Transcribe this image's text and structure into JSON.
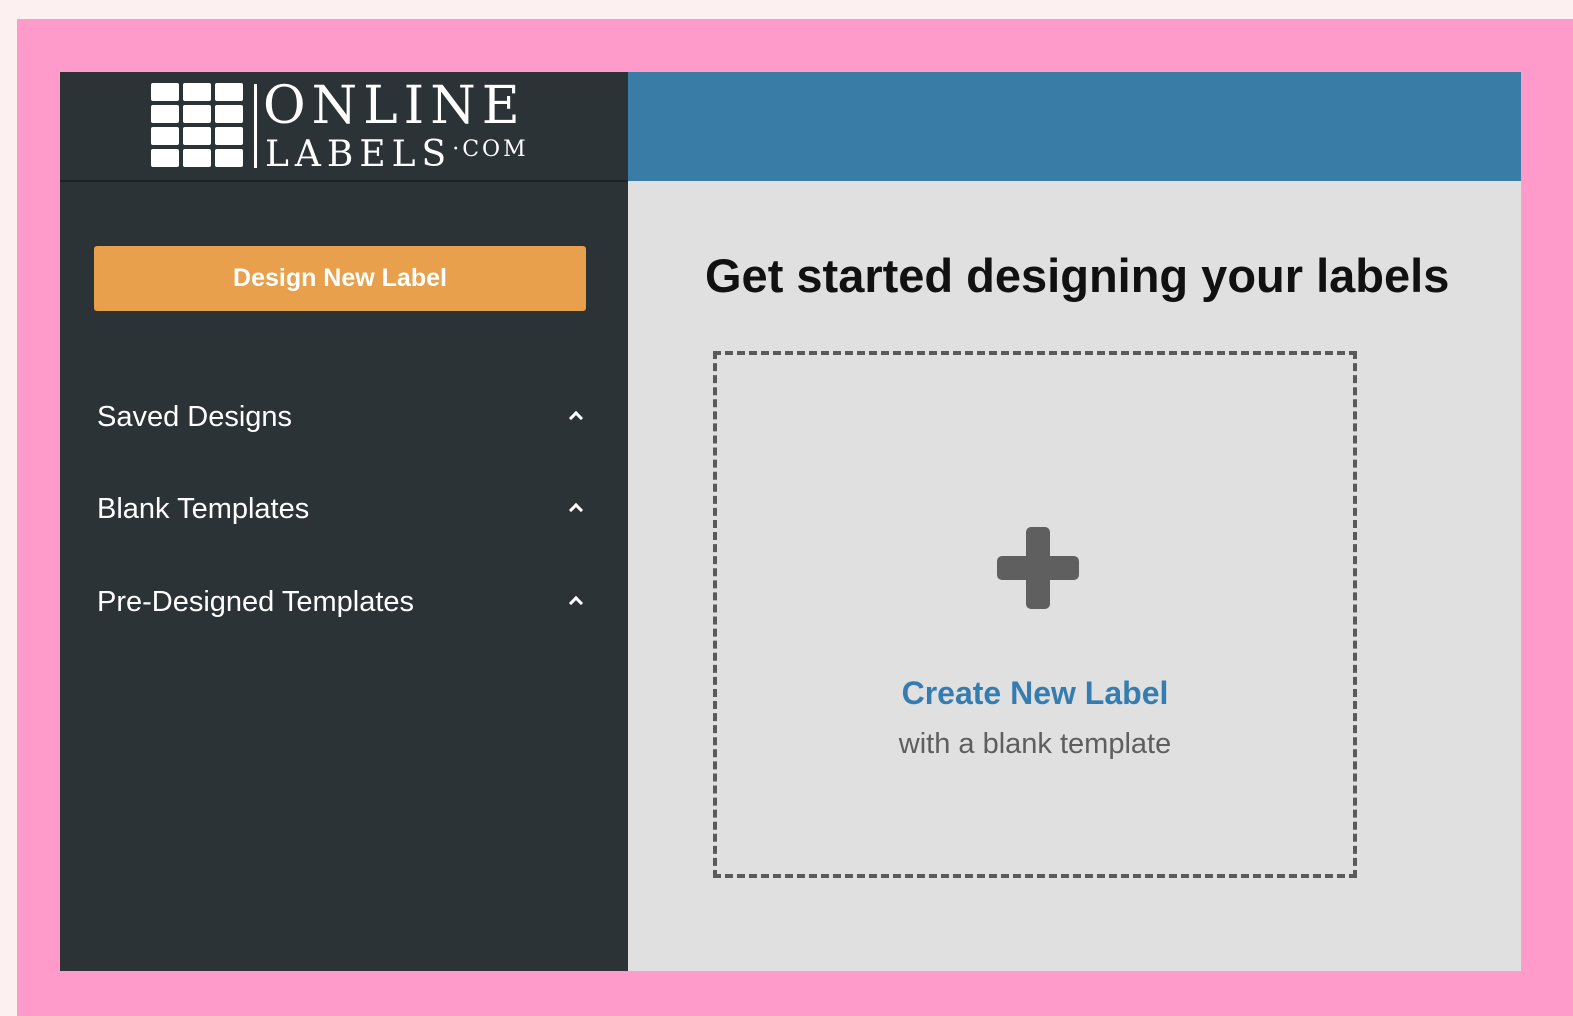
{
  "brand": {
    "logo_line1": "ONLINE",
    "logo_line2": "LABELS",
    "logo_suffix": "·COM",
    "color_sidebar": "#2c3337",
    "color_topbar": "#397ca6",
    "color_accent": "#e8a04c"
  },
  "sidebar": {
    "design_button_label": "Design New Label",
    "items": [
      {
        "label": "Saved Designs",
        "icon": "chevron-up-icon"
      },
      {
        "label": "Blank Templates",
        "icon": "chevron-up-icon"
      },
      {
        "label": "Pre-Designed Templates",
        "icon": "chevron-up-icon"
      }
    ]
  },
  "main": {
    "title": "Get started designing your labels",
    "create_card": {
      "icon": "plus-icon",
      "title": "Create New Label",
      "subtitle": "with a blank template"
    }
  }
}
